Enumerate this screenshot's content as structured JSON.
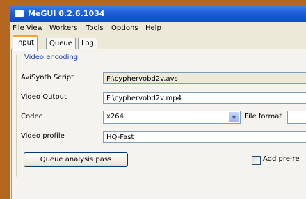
{
  "window": {
    "title": "MeGUI 0.2.6.1034"
  },
  "menu": [
    "File",
    "View",
    "Workers",
    "Tools",
    "Options",
    "Help"
  ],
  "tabs": [
    {
      "label": "Input",
      "active": true
    },
    {
      "label": "Queue",
      "active": false
    },
    {
      "label": "Log",
      "active": false
    }
  ],
  "video_encoding": {
    "legend": "Video encoding",
    "avisynth_label": "AviSynth Script",
    "avisynth_value": "F:\\cyphervobd2v.avs",
    "output_label": "Video Output",
    "output_value": "F:\\cyphervobd2v.mp4",
    "codec_label": "Codec",
    "codec_value": "x264",
    "file_format_label": "File format",
    "profile_label": "Video profile",
    "profile_value": "HQ-Fast",
    "queue_button": "Queue analysis pass",
    "add_prerender_label": "Add pre-re"
  }
}
